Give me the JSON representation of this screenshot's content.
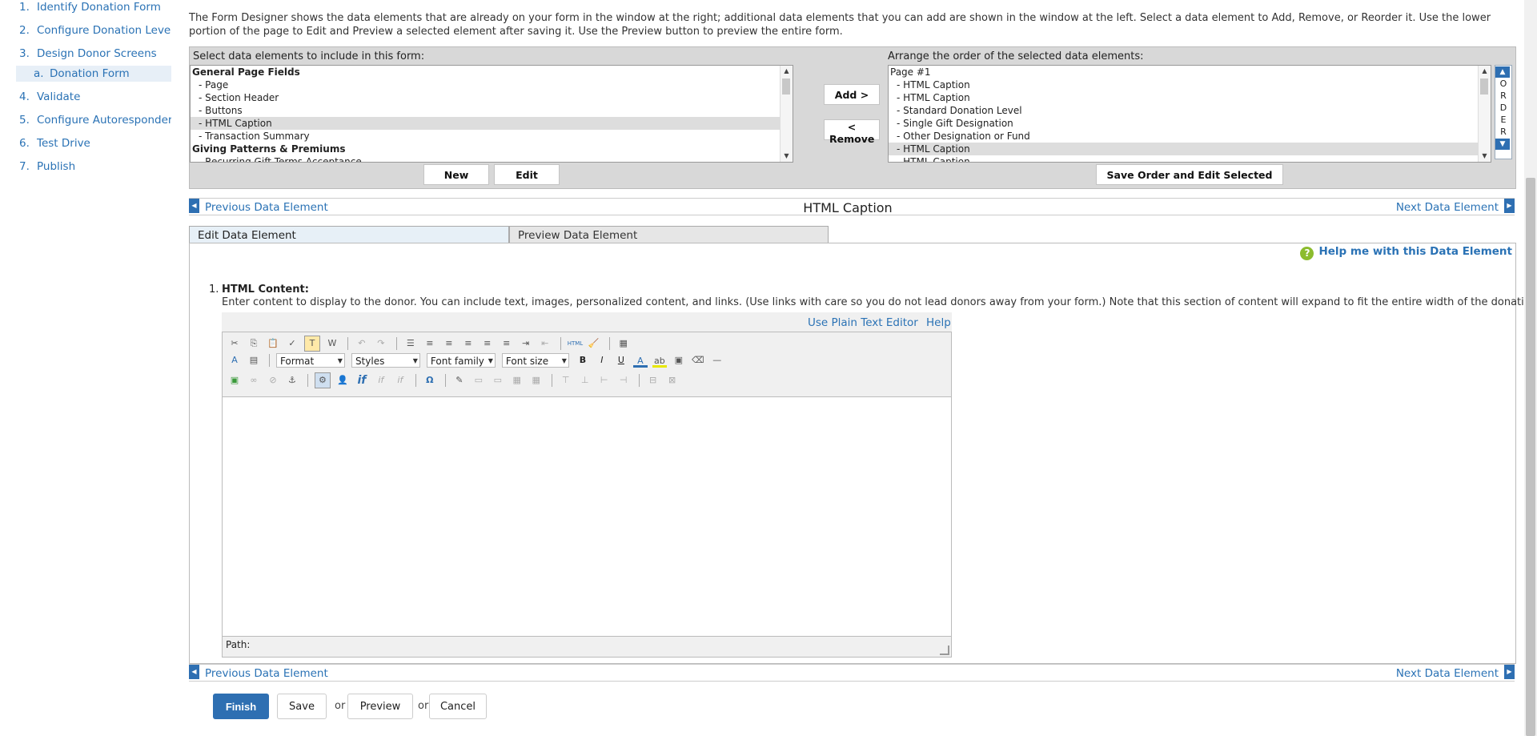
{
  "sidebar": {
    "steps": [
      {
        "num": "1.",
        "label": "Identify Donation Form"
      },
      {
        "num": "2.",
        "label": "Configure Donation Levels"
      },
      {
        "num": "3.",
        "label": "Design Donor Screens"
      },
      {
        "num": "4.",
        "label": "Validate"
      },
      {
        "num": "5.",
        "label": "Configure Autoresponders"
      },
      {
        "num": "6.",
        "label": "Test Drive"
      },
      {
        "num": "7.",
        "label": "Publish"
      }
    ],
    "substep": {
      "num": "a.",
      "label": "Donation Form"
    }
  },
  "intro": "The Form Designer shows the data elements that are already on your form in the window at the right; additional data elements that you can add are shown in the window at the left. Select a data element to Add, Remove, or Reorder it. Use the lower portion of the page to Edit and Preview a selected element after saving it. Use the Preview button to preview the entire form.",
  "designer": {
    "left_label": "Select data elements to include in this form:",
    "right_label": "Arrange the order of the selected data elements:",
    "left_items": [
      {
        "text": "General Page Fields",
        "type": "group"
      },
      {
        "text": "- Page",
        "type": "item"
      },
      {
        "text": "- Section Header",
        "type": "item"
      },
      {
        "text": "- Buttons",
        "type": "item"
      },
      {
        "text": "- HTML Caption",
        "type": "selected"
      },
      {
        "text": "- Transaction Summary",
        "type": "item"
      },
      {
        "text": "Giving Patterns & Premiums",
        "type": "group"
      },
      {
        "text": "- Recurring Gift Terms Acceptance",
        "type": "item"
      }
    ],
    "right_items": [
      {
        "text": "Page #1",
        "type": "page"
      },
      {
        "text": "- HTML Caption",
        "type": "item"
      },
      {
        "text": "- HTML Caption",
        "type": "item"
      },
      {
        "text": "- Standard Donation Level",
        "type": "item"
      },
      {
        "text": "- Single Gift Designation",
        "type": "item"
      },
      {
        "text": "- Other Designation or Fund",
        "type": "item"
      },
      {
        "text": "- HTML Caption",
        "type": "selected"
      },
      {
        "text": "- HTML Caption",
        "type": "item"
      }
    ],
    "add_label": "Add >",
    "remove_label": "< Remove",
    "new_label": "New",
    "edit_label": "Edit",
    "save_order_label": "Save Order and Edit Selected",
    "order_letters": [
      "O",
      "R",
      "D",
      "E",
      "R"
    ]
  },
  "nav": {
    "prev_label": "Previous Data Element",
    "next_label": "Next Data Element",
    "element_title": "HTML Caption"
  },
  "tabs": {
    "edit": "Edit Data Element",
    "preview": "Preview Data Element"
  },
  "edit": {
    "help_label": "Help me with this Data Element",
    "field_num": "1.",
    "field_label": "HTML Content:",
    "field_desc": "Enter content to display to the donor. You can include text, images, personalized content, and links. (Use links with care so you do not lead donors away from your form.) Note that this section of content will expand to fit the entire width of the donation form.",
    "plain_text_label": "Use Plain Text Editor",
    "help_link": "Help",
    "format_label": "Format",
    "styles_label": "Styles",
    "font_family_label": "Font family",
    "font_size_label": "Font size",
    "path_label": "Path:"
  },
  "actions": {
    "finish": "Finish",
    "save": "Save",
    "or": "or",
    "preview": "Preview",
    "cancel": "Cancel"
  }
}
